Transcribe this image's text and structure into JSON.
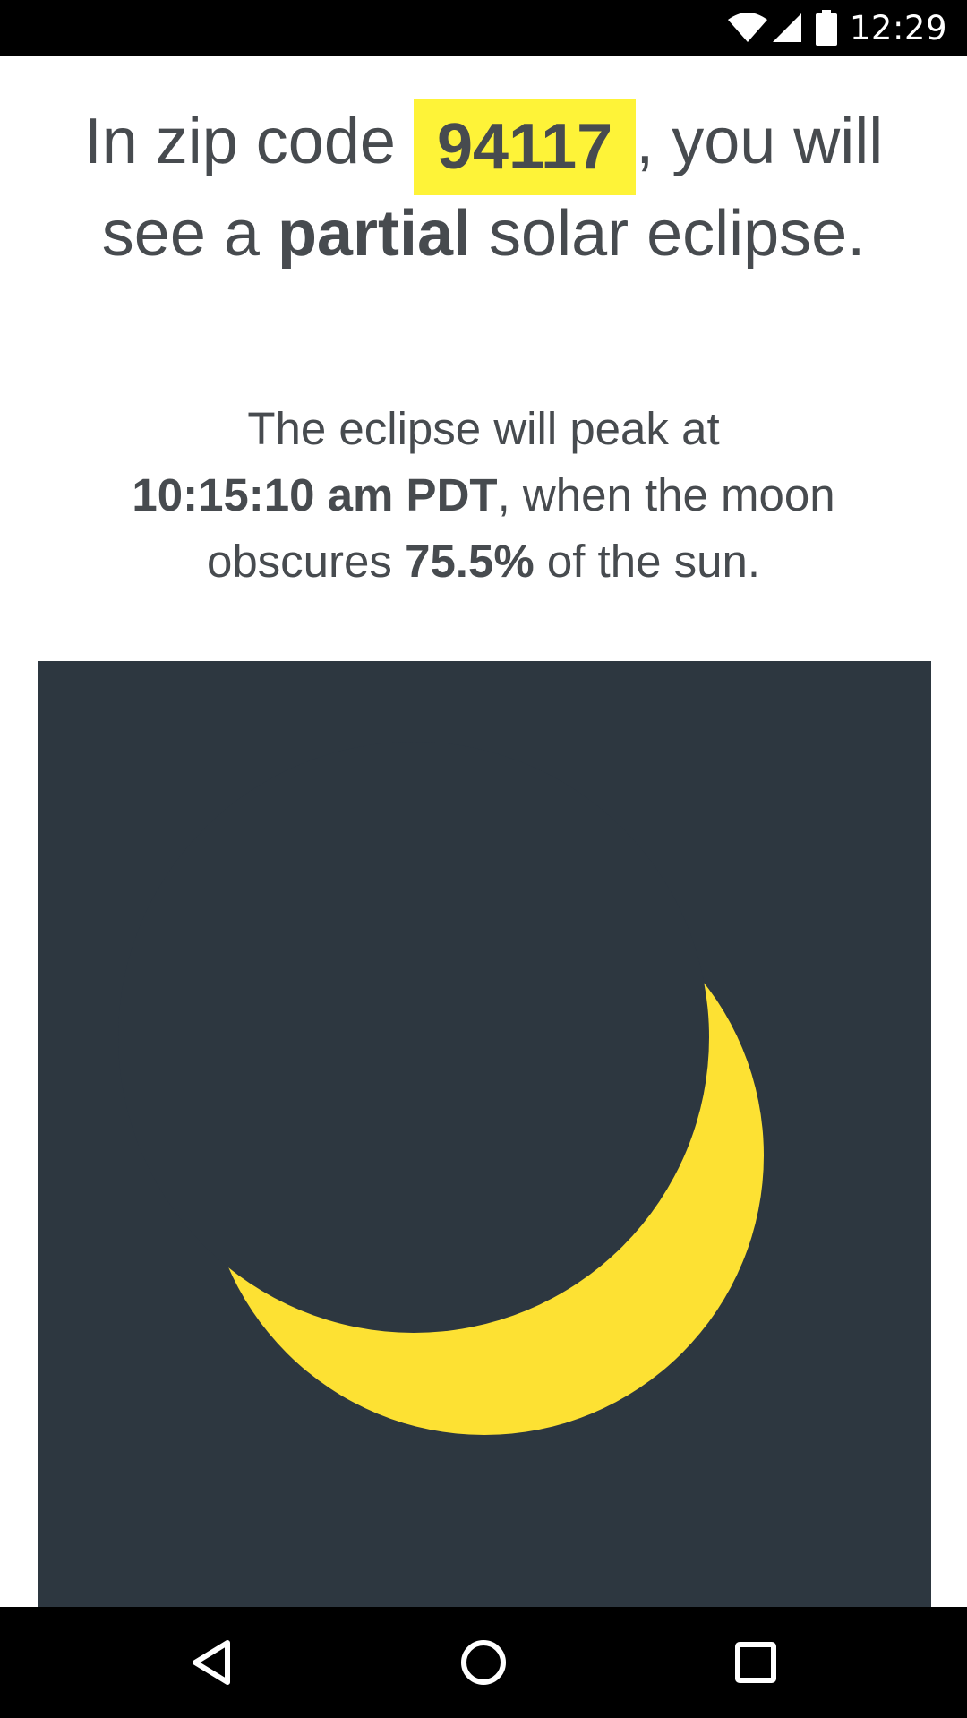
{
  "status_bar": {
    "time": "12:29",
    "icons": [
      "wifi-icon",
      "cellular-signal-icon",
      "battery-icon"
    ]
  },
  "headline": {
    "prefix": "In zip code",
    "zip_code": "94117",
    "middle": ", you will see a",
    "eclipse_type": "partial",
    "suffix": "solar eclipse."
  },
  "peak_info": {
    "prefix": "The eclipse will peak at",
    "time": "10:15:10 am PDT",
    "middle": ", when the moon obscures",
    "obscuration": "75.5%",
    "suffix": "of the sun."
  },
  "eclipse_visual": {
    "obscuration_fraction": 0.755,
    "background_color": "#2d3740",
    "sun_color": "#fde133"
  },
  "nav_bar": {
    "icons": [
      "back-icon",
      "home-icon",
      "recents-icon"
    ]
  },
  "colors": {
    "highlight": "#fef338",
    "text": "#474b4f"
  }
}
